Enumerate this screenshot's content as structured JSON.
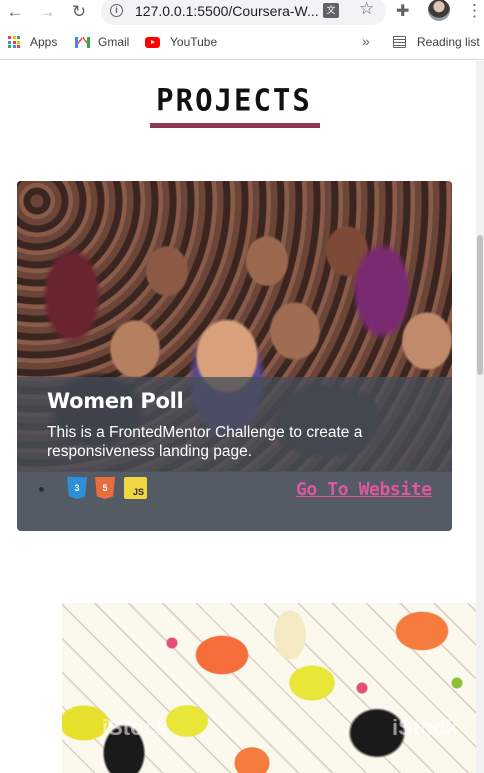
{
  "browser": {
    "url": "127.0.0.1:5500/Coursera-W...",
    "bookmarks": [
      {
        "label": "Apps",
        "icon": "apps-icon"
      },
      {
        "label": "Gmail",
        "icon": "gmail-icon"
      },
      {
        "label": "YouTube",
        "icon": "youtube-icon"
      }
    ],
    "more_bookmarks": "»",
    "reading_list": "Reading list"
  },
  "page": {
    "section_title": "PROJECTS",
    "accent_color": "#8f3558",
    "link_color": "#e0589b",
    "projects": [
      {
        "name": "Women Poll",
        "description": "This is a FrontedMentor Challenge to create a responsiveness landing page.",
        "tech": [
          "CSS3",
          "HTML5",
          "JS"
        ],
        "link_label": "Go To Website"
      }
    ],
    "second_project_watermark": "iStock"
  }
}
